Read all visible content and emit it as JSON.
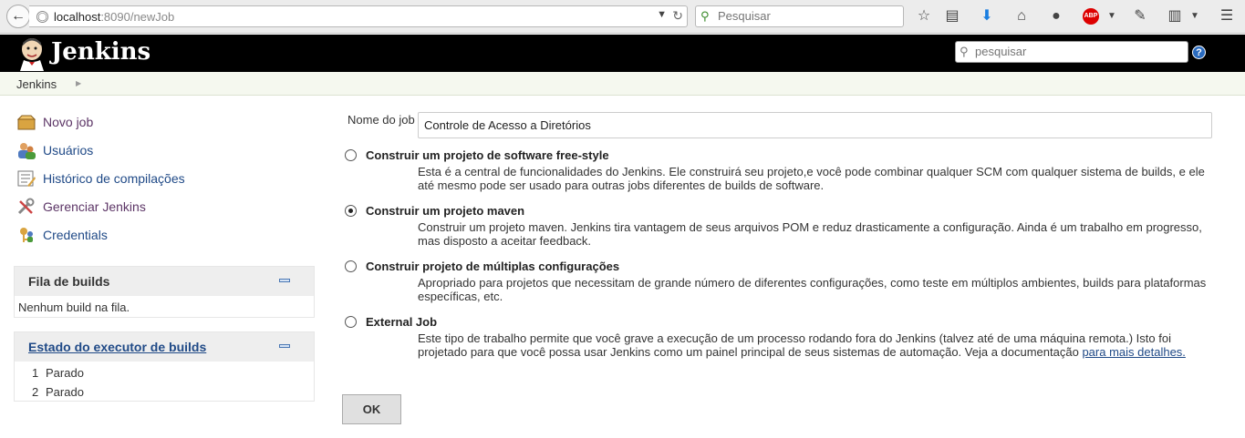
{
  "browser": {
    "url_host": "localhost",
    "url_path": ":8090/newJob",
    "search_placeholder": "Pesquisar",
    "abp_label": "ABP"
  },
  "header": {
    "title": "Jenkins",
    "search_placeholder": "pesquisar",
    "help_label": "?"
  },
  "breadcrumb": {
    "items": [
      "Jenkins"
    ]
  },
  "sidebar": {
    "tasks": [
      {
        "label": "Novo job",
        "icon": "new-job-icon"
      },
      {
        "label": "Usuários",
        "icon": "users-icon"
      },
      {
        "label": "Histórico de compilações",
        "icon": "build-history-icon"
      },
      {
        "label": "Gerenciar Jenkins",
        "icon": "manage-tools-icon"
      },
      {
        "label": "Credentials",
        "icon": "credentials-icon"
      }
    ],
    "queue": {
      "title": "Fila de builds",
      "empty_text": "Nenhum build na fila."
    },
    "executors": {
      "title": "Estado do executor de builds",
      "rows": [
        {
          "num": "1",
          "status": "Parado"
        },
        {
          "num": "2",
          "status": "Parado"
        }
      ]
    }
  },
  "form": {
    "name_label": "Nome do job",
    "name_value": "Controle de Acesso a Diretórios",
    "options": [
      {
        "label": "Construir um projeto de software free-style",
        "desc": "Esta é a central de funcionalidades do Jenkins. Ele construirá seu projeto,e você pode combinar qualquer SCM com qualquer sistema de builds, e ele até mesmo pode ser usado para outras jobs diferentes de builds de software.",
        "selected": false
      },
      {
        "label": "Construir um projeto maven",
        "desc": "Construir um projeto maven. Jenkins tira vantagem de seus arquivos POM e reduz drasticamente a configuração. Ainda é um trabalho em progresso, mas disposto a aceitar feedback.",
        "selected": true
      },
      {
        "label": "Construir projeto de múltiplas configurações",
        "desc": "Apropriado para projetos que necessitam de grande número de diferentes configurações, como teste em múltiplos ambientes, builds para plataformas específicas, etc.",
        "selected": false
      },
      {
        "label": "External Job",
        "desc": "Este tipo de trabalho permite que você grave a execução de um processo rodando fora do Jenkins (talvez até de uma máquina remota.) Isto foi projetado para que você possa usar Jenkins como um painel principal de seus sistemas de automação. Veja a documentação",
        "link": "para mais detalhes.",
        "selected": false
      }
    ],
    "ok_label": "OK"
  }
}
